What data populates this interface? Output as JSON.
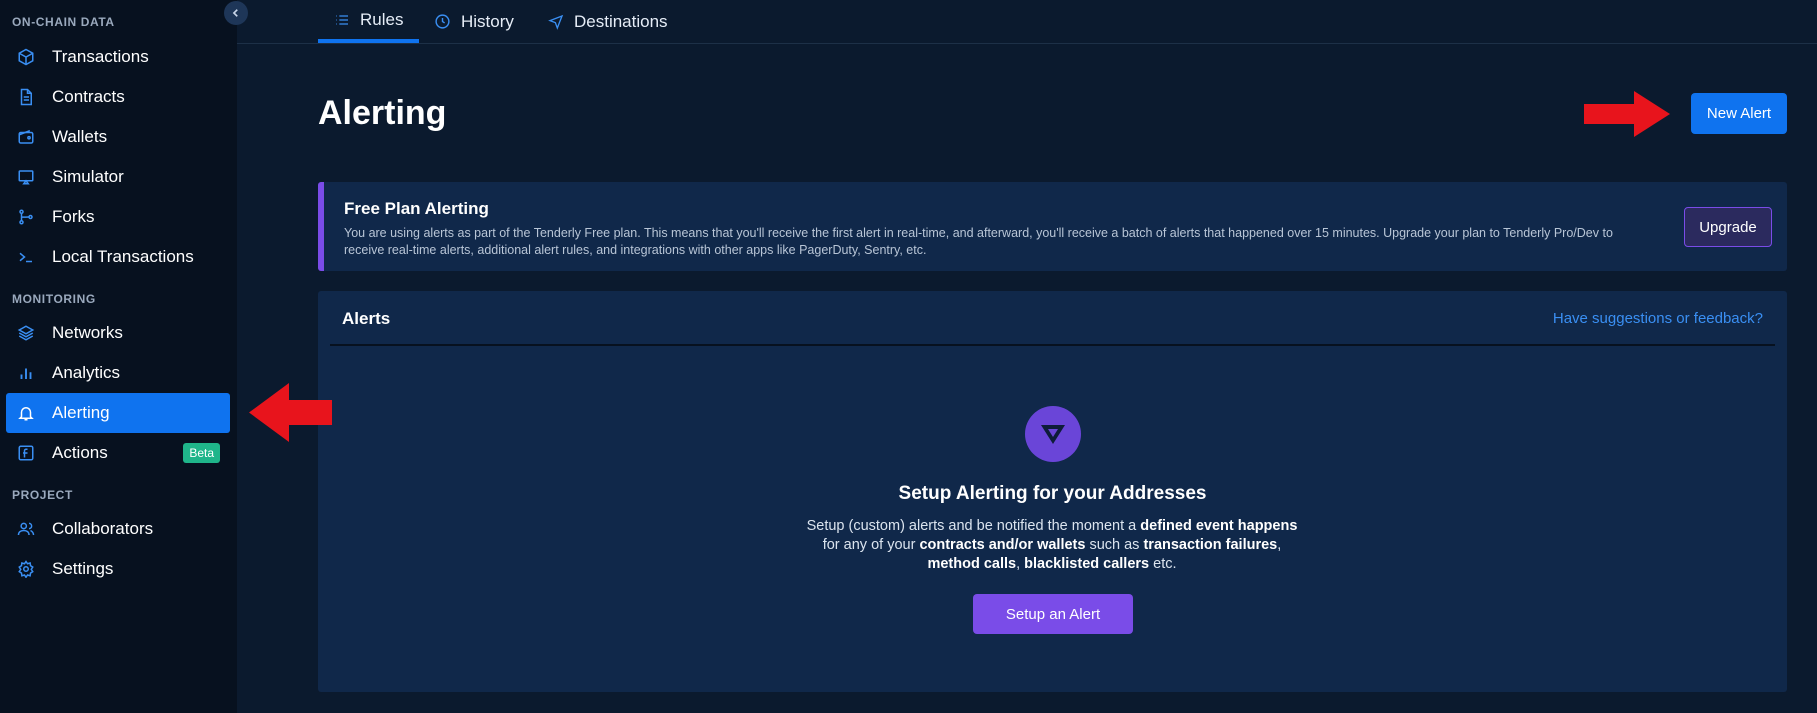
{
  "sidebar": {
    "sections": {
      "onchain": "ON-CHAIN DATA",
      "monitoring": "MONITORING",
      "project": "PROJECT"
    },
    "items": [
      {
        "label": "Transactions",
        "icon": "cube-icon"
      },
      {
        "label": "Contracts",
        "icon": "document-icon"
      },
      {
        "label": "Wallets",
        "icon": "wallet-icon"
      },
      {
        "label": "Simulator",
        "icon": "screen-play-icon"
      },
      {
        "label": "Forks",
        "icon": "git-fork-icon"
      },
      {
        "label": "Local Transactions",
        "icon": "terminal-icon"
      },
      {
        "label": "Networks",
        "icon": "layers-icon"
      },
      {
        "label": "Analytics",
        "icon": "bar-chart-icon"
      },
      {
        "label": "Alerting",
        "icon": "bell-icon",
        "active": true
      },
      {
        "label": "Actions",
        "icon": "function-icon",
        "badge": "Beta"
      },
      {
        "label": "Collaborators",
        "icon": "users-icon"
      },
      {
        "label": "Settings",
        "icon": "gear-icon"
      }
    ]
  },
  "tabs": [
    {
      "label": "Rules",
      "icon": "list-icon",
      "active": true
    },
    {
      "label": "History",
      "icon": "clock-icon"
    },
    {
      "label": "Destinations",
      "icon": "send-icon"
    }
  ],
  "page": {
    "title": "Alerting",
    "new_alert_label": "New Alert"
  },
  "banner": {
    "title": "Free Plan Alerting",
    "text": "You are using alerts as part of the Tenderly Free plan. This means that you'll receive the first alert in real-time, and afterward, you'll receive a batch of alerts that happened over 15 minutes. Upgrade your plan to Tenderly Pro/Dev to receive real-time alerts, additional alert rules, and integrations with other apps like PagerDuty, Sentry, etc.",
    "upgrade_label": "Upgrade"
  },
  "alerts": {
    "title": "Alerts",
    "feedback_link": "Have suggestions or feedback?",
    "empty_title": "Setup Alerting for your Addresses",
    "empty_text": {
      "p1": "Setup (custom) alerts and be notified the moment a ",
      "b1": "defined event happens",
      "p2": "for any of your ",
      "b2": "contracts and/or wallets",
      "p3": " such as ",
      "b3": "transaction failures",
      "p4": ",",
      "b4": "method calls",
      "p5": ", ",
      "b5": "blacklisted callers",
      "p6": " etc."
    },
    "setup_label": "Setup an Alert"
  },
  "colors": {
    "accent": "#0f73ef",
    "purple": "#7a4ce8",
    "annotation_arrow": "#e8141c",
    "beta": "#1fb58a"
  }
}
